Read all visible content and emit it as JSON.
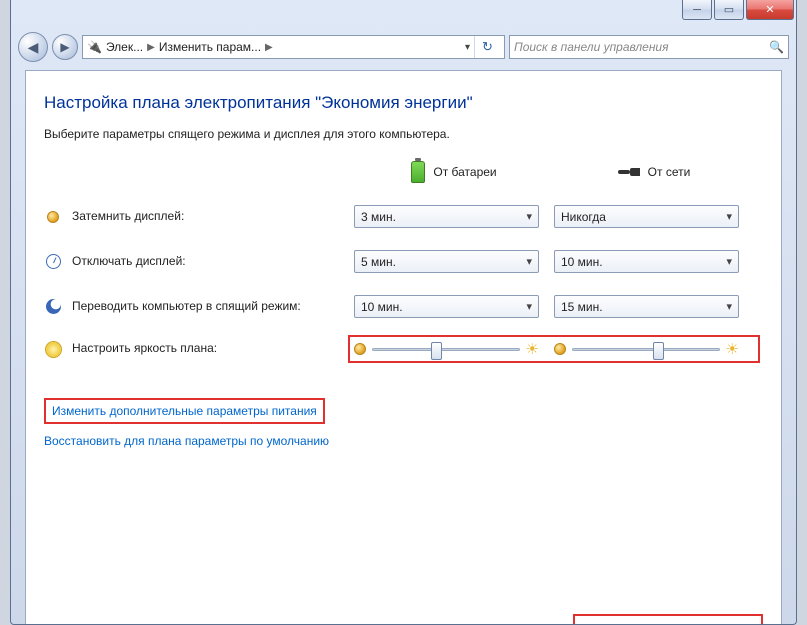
{
  "breadcrumb": {
    "crumb1": "Элек...",
    "crumb2": "Изменить парам..."
  },
  "search": {
    "placeholder": "Поиск в панели управления"
  },
  "page": {
    "title": "Настройка плана электропитания \"Экономия энергии\"",
    "subtitle": "Выберите параметры спящего режима и дисплея для этого компьютера."
  },
  "columns": {
    "battery": "От батареи",
    "plugged": "От сети"
  },
  "rows": {
    "dim": {
      "label": "Затемнить дисплей:",
      "battery": "3 мин.",
      "plugged": "Никогда"
    },
    "off": {
      "label": "Отключать дисплей:",
      "battery": "5 мин.",
      "plugged": "10 мин."
    },
    "sleep": {
      "label": "Переводить компьютер в спящий режим:",
      "battery": "10 мин.",
      "plugged": "15 мин."
    },
    "bright": {
      "label": "Настроить яркость плана:"
    }
  },
  "links": {
    "advanced": "Изменить дополнительные параметры питания",
    "restore": "Восстановить для плана параметры по умолчанию"
  }
}
